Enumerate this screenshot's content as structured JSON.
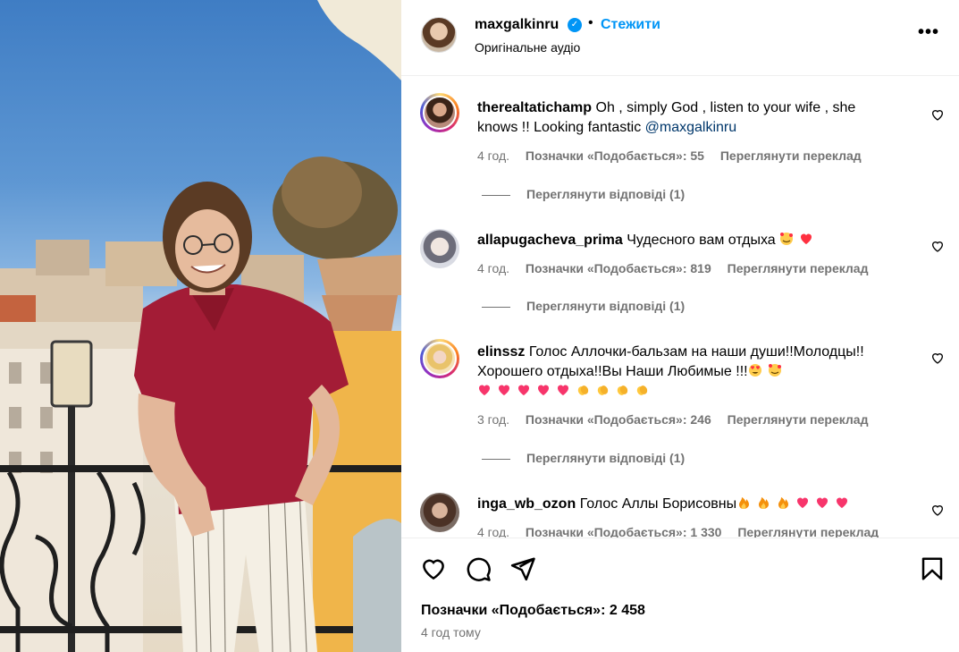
{
  "header": {
    "username": "maxgalkinru",
    "separator": "•",
    "follow_label": "Стежити",
    "audio_label": "Оригінальне аудіо",
    "more_icon": "more-horizontal-icon"
  },
  "comments": [
    {
      "username": "therealtatichamp",
      "text": "Oh , simply God , listen to your wife , she knows !! Looking fantastic ",
      "mention": "@maxgalkinru",
      "time": "4 год.",
      "likes": "Позначки «Подобається»: 55",
      "translate": "Переглянути переклад",
      "replies": "Переглянути відповіді (1)"
    },
    {
      "username": "allapugacheva_prima",
      "text": "Чудесного вам отдыха",
      "time": "4 год.",
      "likes": "Позначки «Подобається»: 819",
      "translate": "Переглянути переклад",
      "replies": "Переглянути відповіді (1)"
    },
    {
      "username": "elinssz",
      "text": "Голос Аллочки-бальзам на наши души!!Молодцы!! Хорошего отдыха!!Вы Наши Любимые !!!",
      "time": "3 год.",
      "likes": "Позначки «Подобається»: 246",
      "translate": "Переглянути переклад",
      "replies": "Переглянути відповіді (1)"
    },
    {
      "username": "inga_wb_ozon",
      "text": "Голос Аллы Борисовны",
      "time": "4 год.",
      "likes": "Позначки «Подобається»: 1 330",
      "translate": "Переглянути переклад"
    }
  ],
  "footer": {
    "likes": "Позначки «Подобається»: 2 458",
    "time_ago": "4 год тому"
  },
  "colors": {
    "accent": "#0095f6",
    "muted": "#737373",
    "heart": "#ff3040"
  }
}
